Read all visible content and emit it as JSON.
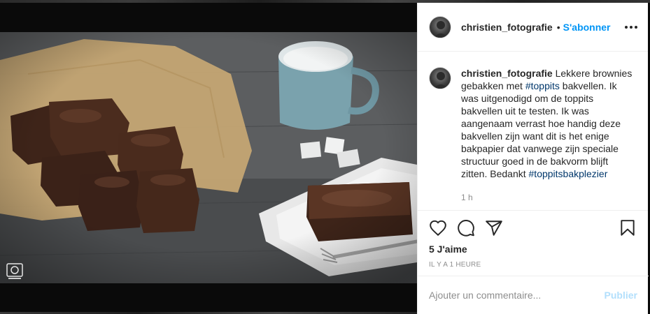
{
  "post": {
    "username": "christien_fotografie",
    "separator": "•",
    "follow_label": "S'abonner",
    "caption": {
      "username": "christien_fotografie",
      "part1": " Lekkere brownies gebakken met ",
      "hashtag1": "#toppits",
      "part2": " bakvellen. Ik was uitgenodigd om de toppits bakvellen uit te testen. Ik was aangenaam verrast hoe handig deze bakvellen zijn want dit is het enige bakpapier dat vanwege zijn speciale structuur goed in de bakvorm blijft zitten. Bedankt ",
      "hashtag2": "#toppitsbakplezier"
    },
    "caption_time": "1 h",
    "likes": "5 J'aime",
    "post_time": "IL Y A 1 HEURE",
    "comment_placeholder": "Ajouter un commentaire...",
    "publish_label": "Publier"
  },
  "icons": {
    "more": "more-options-icon",
    "like": "heart-icon",
    "comment": "comment-icon",
    "share": "share-icon",
    "save": "bookmark-icon"
  },
  "colors": {
    "link": "#0095f6",
    "hashtag": "#00376b",
    "publish_disabled": "#b2dffc",
    "text": "#262626",
    "muted": "#8e8e8e"
  }
}
